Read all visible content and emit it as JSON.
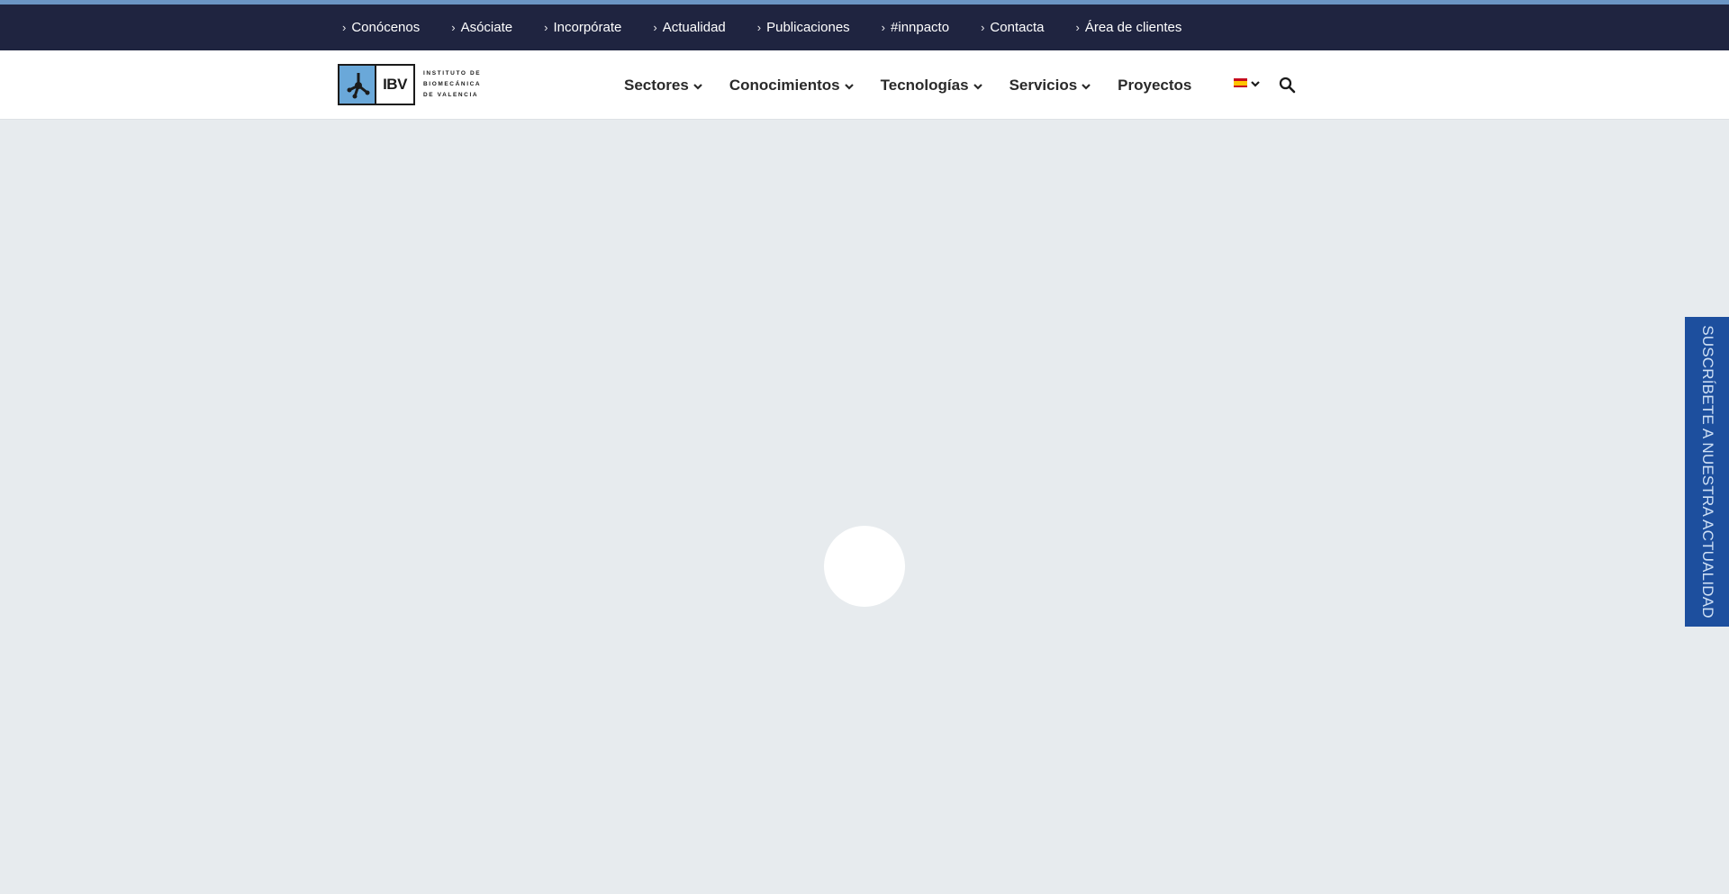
{
  "topbar": {
    "items": [
      {
        "label": "Conócenos"
      },
      {
        "label": "Asóciate"
      },
      {
        "label": "Incorpórate"
      },
      {
        "label": "Actualidad"
      },
      {
        "label": "Publicaciones"
      },
      {
        "label": "#innpacto"
      },
      {
        "label": "Contacta"
      },
      {
        "label": "Área de clientes"
      }
    ]
  },
  "logo": {
    "letters": "IBV",
    "line1": "INSTITUTO DE",
    "line2": "BIOMECÁNICA",
    "line3": "DE VALENCIA"
  },
  "nav": {
    "items": [
      {
        "label": "Sectores",
        "dropdown": true
      },
      {
        "label": "Conocimientos",
        "dropdown": true
      },
      {
        "label": "Tecnologías",
        "dropdown": true
      },
      {
        "label": "Servicios",
        "dropdown": true
      },
      {
        "label": "Proyectos",
        "dropdown": false
      }
    ]
  },
  "language": {
    "icon": "spain-flag-icon"
  },
  "search": {
    "icon": "search-icon"
  },
  "subscribe": {
    "label": "SUSCRÍBETE A NUESTRA ACTUALIDAD"
  },
  "colors": {
    "topbar": "#1f2440",
    "accent": "#6b95c4",
    "subscribe": "#1d4f9e",
    "background": "#e7ebee"
  }
}
